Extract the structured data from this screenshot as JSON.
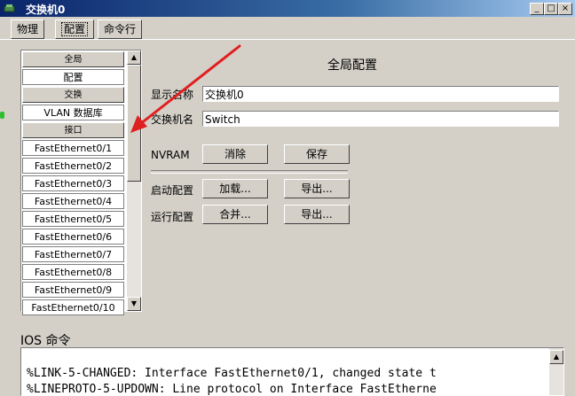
{
  "window": {
    "title": "交换机0",
    "controls": [
      "_",
      "□",
      "×"
    ]
  },
  "tabs": [
    {
      "label": "物理",
      "active": false
    },
    {
      "label": "配置",
      "active": true
    },
    {
      "label": "命令行",
      "active": false
    }
  ],
  "sidebar": {
    "items": [
      {
        "label": "全局",
        "header": true
      },
      {
        "label": "配置",
        "header": false
      },
      {
        "label": "交换",
        "header": true
      },
      {
        "label": "VLAN 数据库",
        "header": false
      },
      {
        "label": "接口",
        "header": true
      },
      {
        "label": "FastEthernet0/1",
        "header": false
      },
      {
        "label": "FastEthernet0/2",
        "header": false
      },
      {
        "label": "FastEthernet0/3",
        "header": false
      },
      {
        "label": "FastEthernet0/4",
        "header": false
      },
      {
        "label": "FastEthernet0/5",
        "header": false
      },
      {
        "label": "FastEthernet0/6",
        "header": false
      },
      {
        "label": "FastEthernet0/7",
        "header": false
      },
      {
        "label": "FastEthernet0/8",
        "header": false
      },
      {
        "label": "FastEthernet0/9",
        "header": false
      },
      {
        "label": "FastEthernet0/10",
        "header": false
      }
    ]
  },
  "global": {
    "title": "全局配置",
    "display_name_label": "显示名称",
    "display_name_value": "交换机0",
    "hostname_label": "交换机名",
    "hostname_value": "Switch",
    "nvram_label": "NVRAM",
    "erase_button": "消除",
    "save_button": "保存",
    "startup_label": "启动配置",
    "load_button": "加载...",
    "export_startup_button": "导出...",
    "running_label": "运行配置",
    "merge_button": "合并...",
    "export_running_button": "导出..."
  },
  "ios": {
    "label": "IOS 命令",
    "lines": [
      "%LINK-5-CHANGED: Interface FastEthernet0/1, changed state t",
      "%LINEPROTO-5-UPDOWN: Line protocol on Interface FastEtherne"
    ]
  },
  "colors": {
    "window_bg": "#d4d0c8",
    "titlebar": "#0a246a",
    "annotation_arrow": "#e02020",
    "status_dot": "#2ebf2e"
  }
}
